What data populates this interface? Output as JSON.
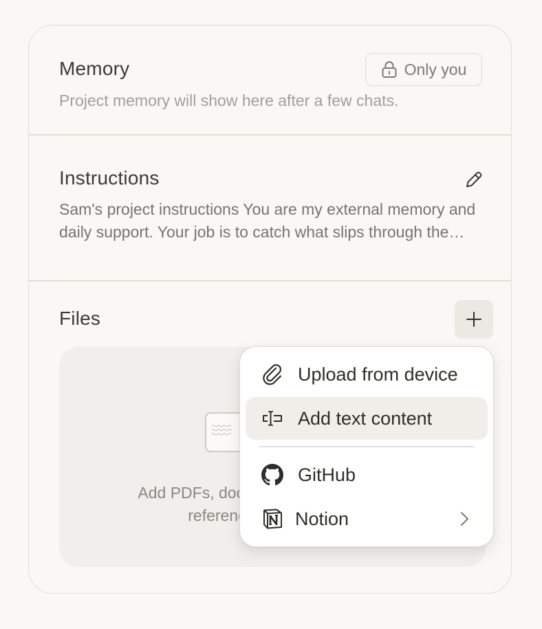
{
  "memory": {
    "title": "Memory",
    "visibility_label": "Only you",
    "placeholder": "Project memory will show here after a few chats."
  },
  "instructions": {
    "title": "Instructions",
    "text": "Sam's project instructions You are my external memory and daily support. Your job is to catch what slips through the cracks and keep me on track."
  },
  "files": {
    "title": "Files",
    "dropzone_line1": "Add PDFs, documents, or other text to",
    "dropzone_line2": "reference in this project."
  },
  "add_menu": {
    "items": [
      {
        "label": "Upload from device",
        "icon": "paperclip-icon"
      },
      {
        "label": "Add text content",
        "icon": "text-cursor-icon"
      },
      {
        "label": "GitHub",
        "icon": "github-icon"
      },
      {
        "label": "Notion",
        "icon": "notion-icon"
      }
    ]
  },
  "colors": {
    "background": "#f9f8f5",
    "border": "#e1ded8",
    "hover": "#f0eee9",
    "text_primary": "#3b3a37",
    "text_muted": "#a29f98"
  }
}
